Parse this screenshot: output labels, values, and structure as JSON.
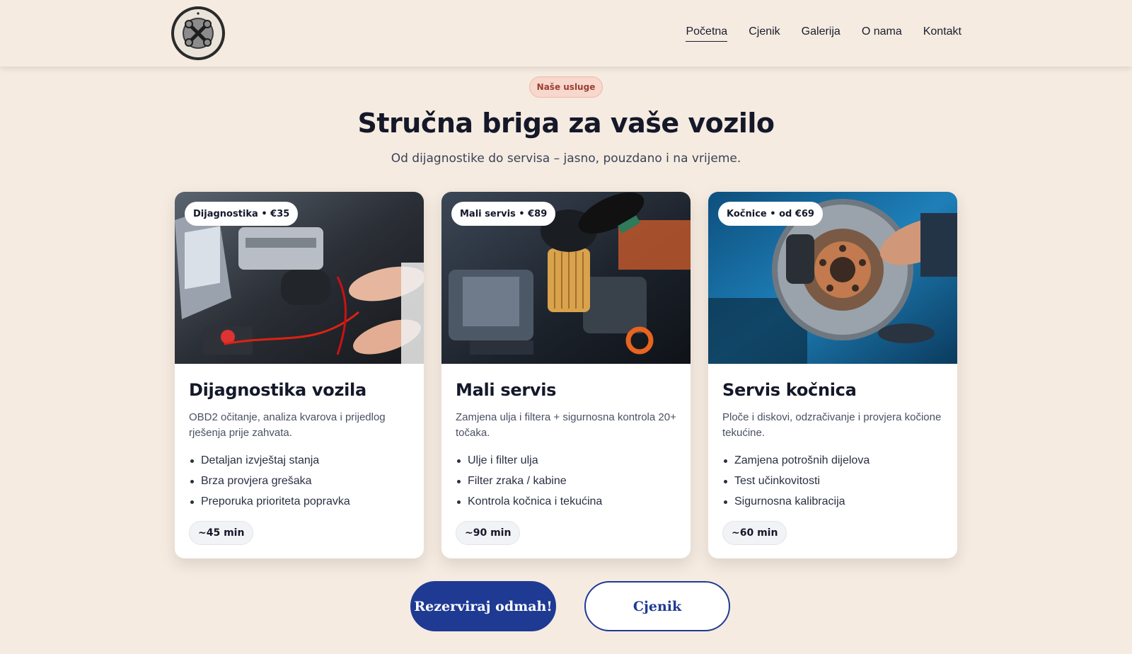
{
  "header": {
    "logo_alt": "Mehaničarska radnja – sve za vaše vozilo",
    "nav": [
      {
        "label": "Početna",
        "active": true
      },
      {
        "label": "Cjenik",
        "active": false
      },
      {
        "label": "Galerija",
        "active": false
      },
      {
        "label": "O nama",
        "active": false
      },
      {
        "label": "Kontakt",
        "active": false
      }
    ]
  },
  "hero": {
    "pill": "Naše usluge",
    "title": "Stručna briga za vaše vozilo",
    "subtitle": "Od dijagnostike do servisa – jasno, pouzdano i na vrijeme."
  },
  "cards": [
    {
      "tag": "Dijagnostika • €35",
      "title": "Dijagnostika vozila",
      "description": "OBD2 očitanje, analiza kvarova i prijedlog rješenja prije zahvata.",
      "items": [
        "Detaljan izvještaj stanja",
        "Brza provjera grešaka",
        "Preporuka prioriteta popravka"
      ],
      "time": "~45 min",
      "image_icon": "engine-diagnostics-photo"
    },
    {
      "tag": "Mali servis • €89",
      "title": "Mali servis",
      "description": "Zamjena ulja i filtera + sigurnosna kontrola 20+ točaka.",
      "items": [
        "Ulje i filter ulja",
        "Filter zraka / kabine",
        "Kontrola kočnica i tekućina"
      ],
      "time": "~90 min",
      "image_icon": "oil-filter-photo"
    },
    {
      "tag": "Kočnice • od €69",
      "title": "Servis kočnica",
      "description": "Ploče i diskovi, odzračivanje i provjera kočione tekućine.",
      "items": [
        "Zamjena potrošnih dijelova",
        "Test učinkovitosti",
        "Sigurnosna kalibracija"
      ],
      "time": "~60 min",
      "image_icon": "brake-disc-photo"
    }
  ],
  "actions": {
    "primary": "Rezerviraj odmah!",
    "secondary": "Cjenik"
  },
  "colors": {
    "background": "#f5ebe1",
    "accent": "#1f3a93",
    "pill_bg": "#f8d7cd",
    "pill_text": "#9a3f32"
  }
}
